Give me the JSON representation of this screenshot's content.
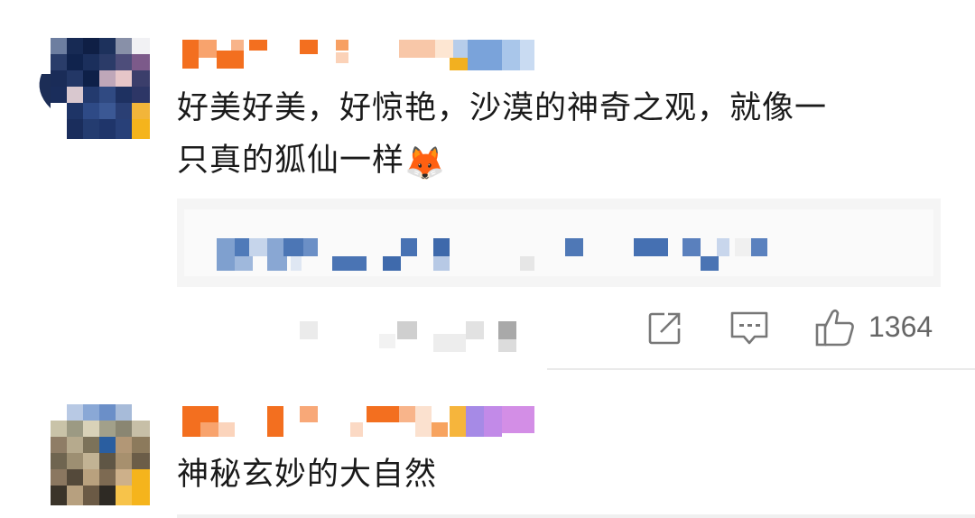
{
  "comments": [
    {
      "text_line1": "好美好美，好惊艳，沙漠的神奇之观，就像一",
      "text_line2": "只真的狐仙一样",
      "emoji": "🦊",
      "like_count": "1364"
    },
    {
      "text": "神秘玄妙的大自然"
    }
  ],
  "icons": {
    "share": "share-icon",
    "comment": "comment-icon",
    "like": "thumbs-up-icon"
  },
  "colors": {
    "text": "#1a1a1a",
    "meta": "#666666",
    "reply_bg": "#f4f4f4",
    "mosaic_orange": "#f36f1f",
    "mosaic_blue": "#5b86c5"
  }
}
